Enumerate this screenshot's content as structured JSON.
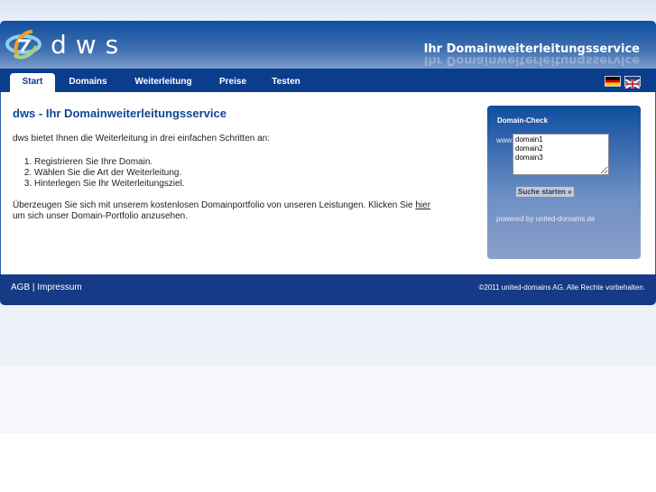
{
  "header": {
    "logo_text": "dws",
    "slogan": "Ihr Domainweiterleitungsservice"
  },
  "nav": {
    "tabs": [
      {
        "label": "Start",
        "active": true
      },
      {
        "label": "Domains"
      },
      {
        "label": "Weiterleitung"
      },
      {
        "label": "Preise"
      },
      {
        "label": "Testen"
      }
    ],
    "flags": [
      "german-flag-icon",
      "uk-flag-icon"
    ]
  },
  "main": {
    "title": "dws - Ihr Domainweiterleitungsservice",
    "intro": "dws bietet Ihnen die Weiterleitung in drei einfachen Schritten an:",
    "steps": [
      "Registrieren Sie Ihre Domain.",
      "Wählen Sie die Art der Weiterleitung.",
      "Hinterlegen Sie Ihr Weiterleitungsziel."
    ],
    "outro_before": "Überzeugen Sie sich mit unserem kostenlosen Domainportfolio von unseren Leistungen. Klicken Sie ",
    "outro_link": "hier",
    "outro_after": "um sich unser Domain-Portfolio anzusehen."
  },
  "domain_check": {
    "title": "Domain-Check",
    "prefix": "www.",
    "textarea_value": "domain1\ndomain2\ndomain3",
    "button": "Suche starten »",
    "powered": "powered by united-domains.de"
  },
  "footer": {
    "agb": "AGB",
    "separator": "|",
    "impressum": "Impressum",
    "copyright": "©2011 united-domains AG. Alle Rechte vorbehalten."
  }
}
